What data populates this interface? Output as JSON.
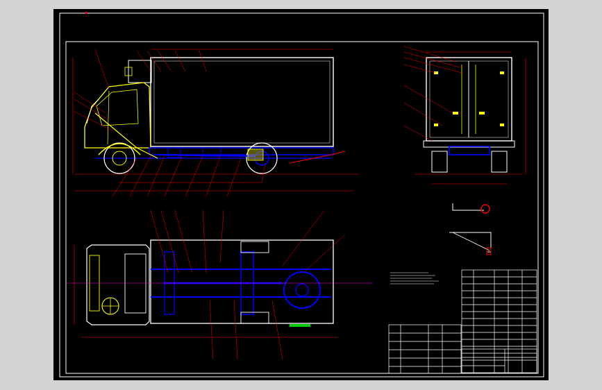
{
  "drawing": {
    "background_color": "#000000",
    "workspace_color": "#d4d4d4",
    "frame_color": "#ffffff",
    "colors": {
      "outline": "#ffffff",
      "dimension": "#ff0000",
      "chassis": "#0000ff",
      "highlight": "#ffff00",
      "accent_green": "#00cc00",
      "accent_magenta": "#ff00ff"
    }
  },
  "views": [
    {
      "name": "side-elevation-view"
    },
    {
      "name": "rear-elevation-view"
    },
    {
      "name": "top-plan-view"
    },
    {
      "name": "detail-views"
    }
  ],
  "tables": {
    "parts_list": {
      "rows": 14,
      "columns": 5
    },
    "title_block": {
      "rows": 6
    }
  }
}
